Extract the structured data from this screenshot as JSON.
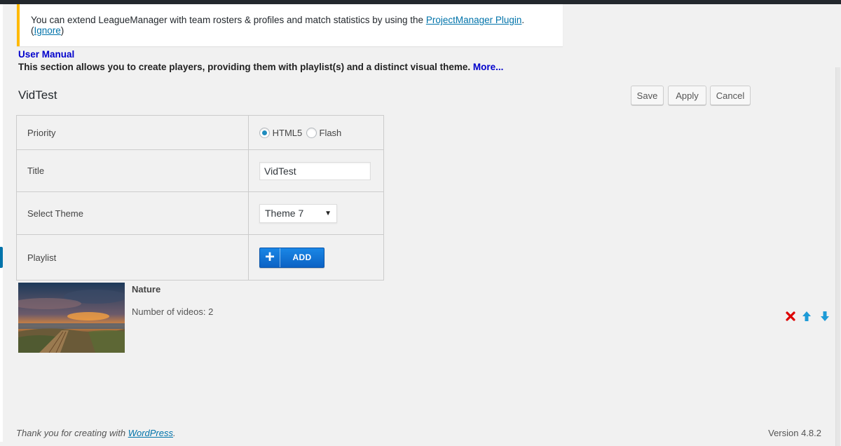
{
  "notice": {
    "text": "You can extend LeagueManager with team rosters & profiles and match statistics by using the",
    "link": "ProjectManager Plugin",
    "after_link": ". (",
    "ignore": "Ignore",
    "close_paren": ")"
  },
  "help": {
    "manual_link": "User Manual",
    "description": "This section allows you to create players, providing them with playlist(s) and a distinct visual theme.",
    "more_link": "More..."
  },
  "page": {
    "title": "VidTest"
  },
  "toolbar": {
    "save": "Save",
    "apply": "Apply",
    "cancel": "Cancel"
  },
  "form": {
    "priority": {
      "label": "Priority",
      "options": [
        "HTML5",
        "Flash"
      ],
      "selected": "HTML5"
    },
    "title": {
      "label": "Title",
      "value": "VidTest"
    },
    "theme": {
      "label": "Select Theme",
      "value": "Theme 7"
    },
    "playlist": {
      "label": "Playlist",
      "add_button": "ADD"
    }
  },
  "playlist_items": [
    {
      "name": "Nature",
      "count_text": "Number of videos: 2",
      "actions": [
        "delete-icon",
        "move-up-icon",
        "move-down-icon"
      ]
    }
  ],
  "footer": {
    "thanks_prefix": "Thank you for creating with",
    "wp_link": "WordPress",
    "period": ".",
    "version": "Version 4.8.2"
  },
  "colors": {
    "notice_border": "#ffb900",
    "link": "#0073aa",
    "manual_link": "#0000cc",
    "add_button": "#1a87e6",
    "delete": "#dd0000",
    "arrow": "#1e9bd7"
  }
}
